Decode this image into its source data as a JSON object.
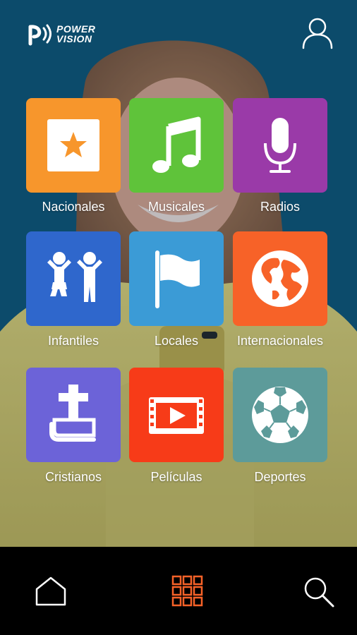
{
  "brand": {
    "line1": "POWER",
    "line2": "VISION"
  },
  "categories": [
    {
      "label": "Nacionales",
      "color": "#f7962c",
      "icon": "star-icon"
    },
    {
      "label": "Musicales",
      "color": "#5fc33a",
      "icon": "music-note-icon"
    },
    {
      "label": "Radios",
      "color": "#9a3aa8",
      "icon": "microphone-icon"
    },
    {
      "label": "Infantiles",
      "color": "#2f67cc",
      "icon": "children-icon"
    },
    {
      "label": "Locales",
      "color": "#3b9bd6",
      "icon": "flag-icon"
    },
    {
      "label": "Internacionales",
      "color": "#f76228",
      "icon": "globe-icon"
    },
    {
      "label": "Cristianos",
      "color": "#6c63d8",
      "icon": "bible-cross-icon"
    },
    {
      "label": "Películas",
      "color": "#f73b18",
      "icon": "film-play-icon"
    },
    {
      "label": "Deportes",
      "color": "#5d9b9a",
      "icon": "soccer-ball-icon"
    }
  ],
  "nav": {
    "active": "categories",
    "accent": "#f76228"
  }
}
